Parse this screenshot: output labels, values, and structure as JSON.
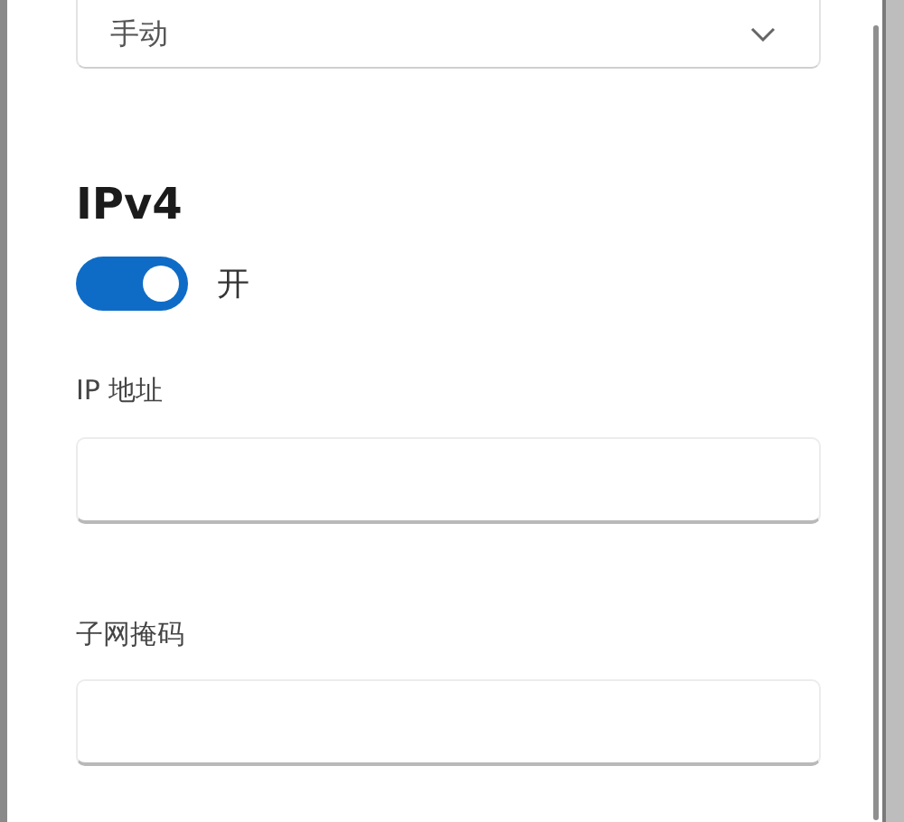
{
  "dropdown": {
    "value": "手动"
  },
  "section": {
    "title": "IPv4"
  },
  "toggle": {
    "on": true,
    "label": "开"
  },
  "fields": [
    {
      "label": "IP 地址"
    },
    {
      "label": "子网掩码"
    }
  ]
}
